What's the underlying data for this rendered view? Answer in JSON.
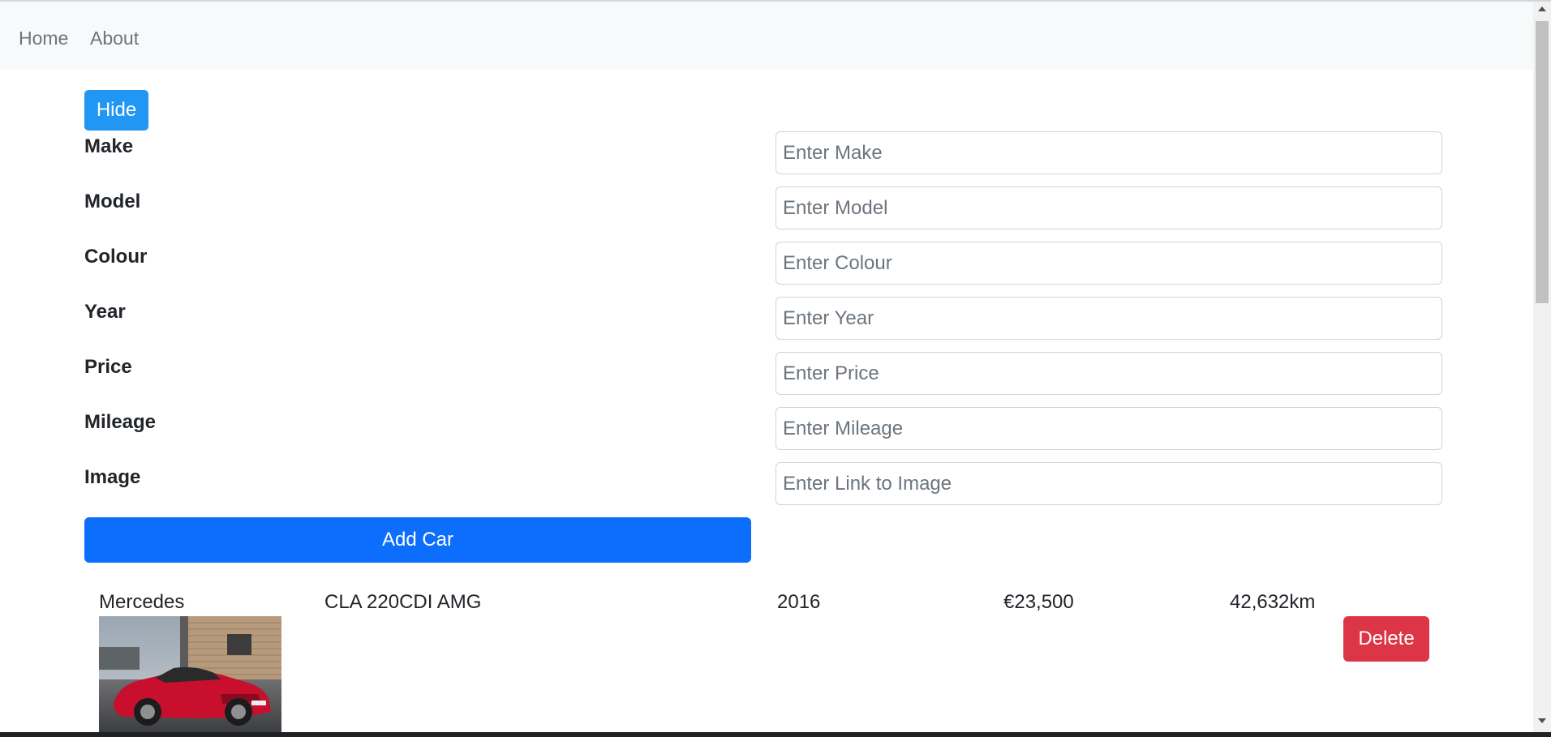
{
  "nav": {
    "home": "Home",
    "about": "About"
  },
  "form": {
    "hide_label": "Hide",
    "fields": [
      {
        "label": "Make",
        "placeholder": "Enter Make"
      },
      {
        "label": "Model",
        "placeholder": "Enter Model"
      },
      {
        "label": "Colour",
        "placeholder": "Enter Colour"
      },
      {
        "label": "Year",
        "placeholder": "Enter Year"
      },
      {
        "label": "Price",
        "placeholder": "Enter Price"
      },
      {
        "label": "Mileage",
        "placeholder": "Enter Mileage"
      },
      {
        "label": "Image",
        "placeholder": "Enter Link to Image"
      }
    ],
    "add_label": "Add Car"
  },
  "cars": [
    {
      "make": "Mercedes",
      "model": "CLA 220CDI AMG",
      "year": "2016",
      "price": "€23,500",
      "mileage": "42,632km",
      "image": "red-mercedes-car-photo",
      "delete_label": "Delete"
    }
  ],
  "colors": {
    "primary": "#0d6efd",
    "hide_button": "#2196f3",
    "danger": "#dc3545",
    "navbar_bg": "#f8f9fa",
    "nav_link": "#6c757d"
  }
}
